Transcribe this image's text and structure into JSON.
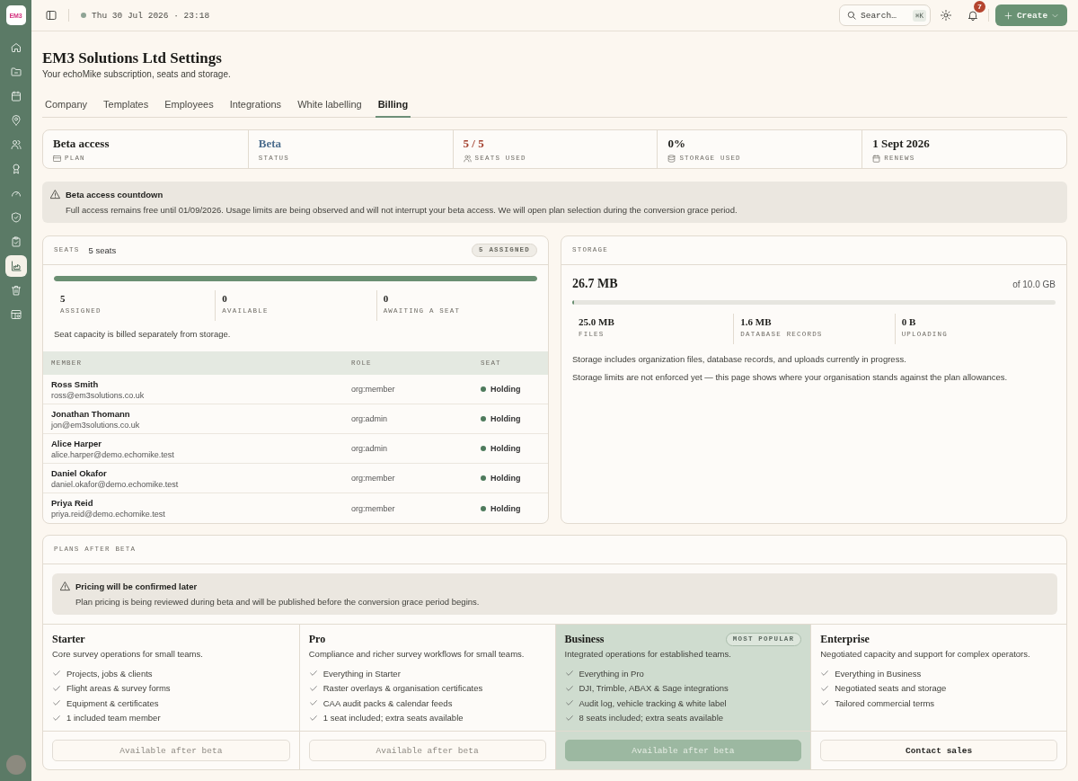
{
  "sidebar": {
    "logo": "EM3",
    "items": [
      {
        "selected": false
      },
      {
        "selected": false
      },
      {
        "selected": false
      },
      {
        "selected": false
      },
      {
        "selected": false
      },
      {
        "selected": false
      },
      {
        "selected": false
      },
      {
        "selected": false
      },
      {
        "selected": false
      },
      {
        "selected": true
      },
      {
        "selected": false
      },
      {
        "selected": false
      }
    ]
  },
  "topbar": {
    "datetime": "Thu 30 Jul 2026 · 23:18",
    "search": {
      "label": "Search…",
      "shortcut": "⌘K"
    },
    "notifications": "7",
    "create_button": "Create"
  },
  "header": {
    "title": "EM3 Solutions Ltd Settings",
    "subtitle": "Your echoMike subscription, seats and storage."
  },
  "tabs": [
    {
      "label": "Company",
      "selected": false
    },
    {
      "label": "Templates",
      "selected": false
    },
    {
      "label": "Employees",
      "selected": false
    },
    {
      "label": "Integrations",
      "selected": false
    },
    {
      "label": "White labelling",
      "selected": false
    },
    {
      "label": "Billing",
      "selected": true
    }
  ],
  "stats": [
    {
      "value": "Beta access",
      "label": "PLAN",
      "color": "#1f1f1c"
    },
    {
      "value": "Beta",
      "label": "STATUS",
      "color": "#4d6e8e"
    },
    {
      "value": "5 / 5",
      "label": "SEATS USED",
      "color": "#a3402e"
    },
    {
      "value": "0%",
      "label": "STORAGE USED",
      "color": "#1f1f1c"
    },
    {
      "value": "1 Sept 2026",
      "label": "RENEWS",
      "color": "#1f1f1c"
    }
  ],
  "notice": {
    "title": "Beta access countdown",
    "text": "Full access remains free until 01/09/2026. Usage limits are being observed and will not interrupt your beta access. We will open plan selection during the conversion grace period."
  },
  "seats": {
    "title": "SEATS",
    "count": "5 seats",
    "badge": "5 ASSIGNED",
    "level": 1,
    "figures": [
      {
        "value": "5",
        "label": "ASSIGNED"
      },
      {
        "value": "0",
        "label": "AVAILABLE"
      },
      {
        "value": "0",
        "label": "AWAITING A SEAT"
      }
    ],
    "note": "Seat capacity is billed separately from storage.",
    "columns": [
      "MEMBER",
      "ROLE",
      "SEAT"
    ],
    "members": [
      {
        "name": "Ross Smith",
        "email": "ross@em3solutions.co.uk",
        "role": "org:member",
        "seat": "Holding"
      },
      {
        "name": "Jonathan Thomann",
        "email": "jon@em3solutions.co.uk",
        "role": "org:admin",
        "seat": "Holding"
      },
      {
        "name": "Alice Harper",
        "email": "alice.harper@demo.echomike.test",
        "role": "org:admin",
        "seat": "Holding"
      },
      {
        "name": "Daniel Okafor",
        "email": "daniel.okafor@demo.echomike.test",
        "role": "org:member",
        "seat": "Holding"
      },
      {
        "name": "Priya Reid",
        "email": "priya.reid@demo.echomike.test",
        "role": "org:member",
        "seat": "Holding"
      }
    ]
  },
  "storage": {
    "title": "STORAGE",
    "used": "26.7 MB",
    "total": "of 10.0 GB",
    "level": 0.003,
    "figures": [
      {
        "value": "25.0 MB",
        "label": "FILES"
      },
      {
        "value": "1.6 MB",
        "label": "DATABASE RECORDS"
      },
      {
        "value": "0 B",
        "label": "UPLOADING"
      }
    ],
    "notes": [
      "Storage includes organization files, database records, and uploads currently in progress.",
      "Storage limits are not enforced yet — this page shows where your organisation stands against the plan allowances."
    ]
  },
  "plans": {
    "title": "PLANS AFTER BETA",
    "notice": {
      "title": "Pricing will be confirmed later",
      "text": "Plan pricing is being reviewed during beta and will be published before the conversion grace period begins."
    },
    "items": [
      {
        "name": "Starter",
        "description": "Core survey operations for small teams.",
        "features": [
          "Projects, jobs & clients",
          "Flight areas & survey forms",
          "Equipment & certificates",
          "1 included team member"
        ],
        "featured": false,
        "button": {
          "label": "Available after beta",
          "disabled": true
        }
      },
      {
        "name": "Pro",
        "description": "Compliance and richer survey workflows for small teams.",
        "features": [
          "Everything in Starter",
          "Raster overlays & organisation certificates",
          "CAA audit packs & calendar feeds",
          "1 seat included; extra seats available"
        ],
        "featured": false,
        "button": {
          "label": "Available after beta",
          "disabled": true
        }
      },
      {
        "name": "Business",
        "badge": "MOST POPULAR",
        "description": "Integrated operations for established teams.",
        "features": [
          "Everything in Pro",
          "DJI, Trimble, ABAX & Sage integrations",
          "Audit log, vehicle tracking & white label",
          "8 seats included; extra seats available"
        ],
        "featured": true,
        "button": {
          "label": "Available after beta",
          "disabled": true
        }
      },
      {
        "name": "Enterprise",
        "description": "Negotiated capacity and support for complex operators.",
        "features": [
          "Everything in Business",
          "Negotiated seats and storage",
          "Tailored commercial terms"
        ],
        "featured": false,
        "button": {
          "label": "Contact sales",
          "disabled": false
        }
      }
    ]
  }
}
